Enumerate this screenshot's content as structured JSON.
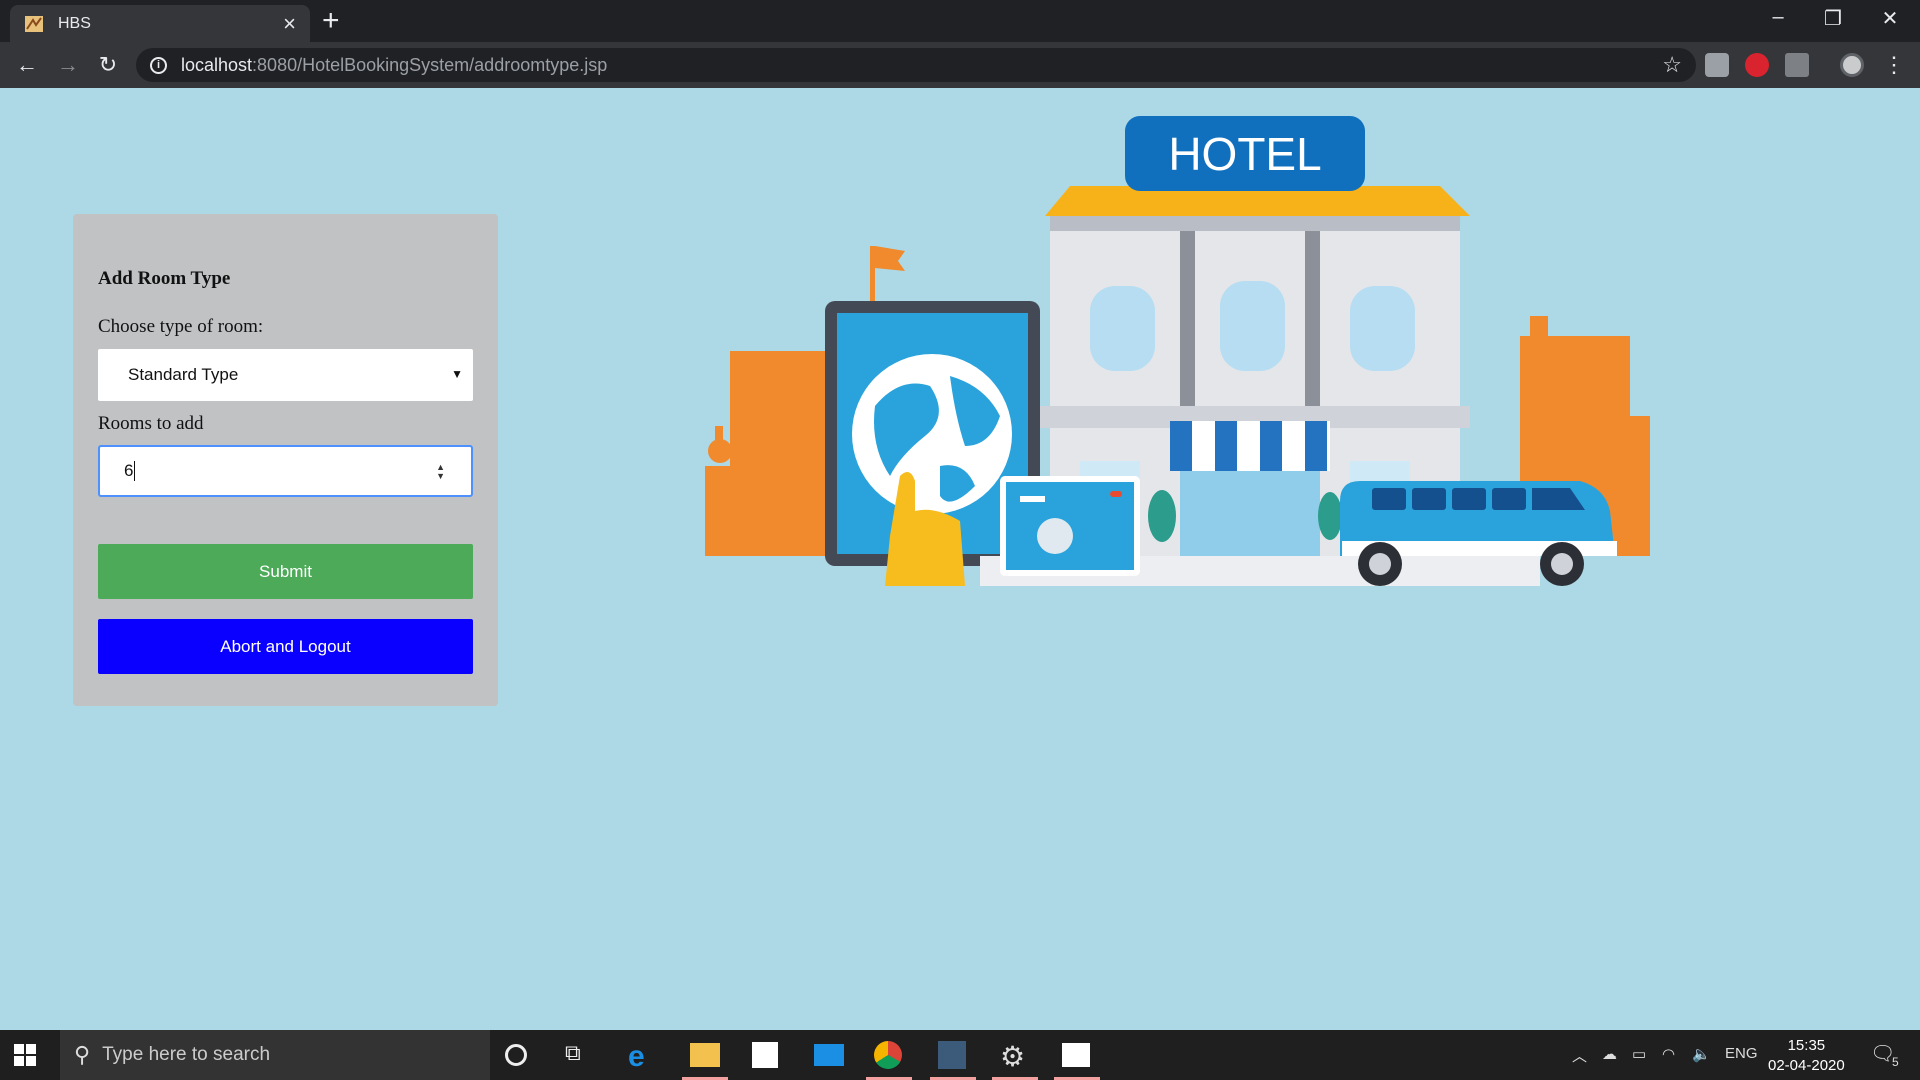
{
  "browser": {
    "tab_title": "HBS",
    "url_host": "localhost",
    "url_rest": ":8080/HotelBookingSystem/addroomtype.jsp"
  },
  "form": {
    "title": "Add Room Type",
    "room_type_label": "Choose type of room:",
    "room_type_value": "Standard Type",
    "rooms_label": "Rooms to add",
    "rooms_value": "6",
    "submit_label": "Submit",
    "abort_label": "Abort and Logout"
  },
  "hero": {
    "sign_text": "HOTEL"
  },
  "taskbar": {
    "search_placeholder": "Type here to search",
    "language": "ENG",
    "time": "15:35",
    "date": "02-04-2020",
    "notifications": "5"
  }
}
